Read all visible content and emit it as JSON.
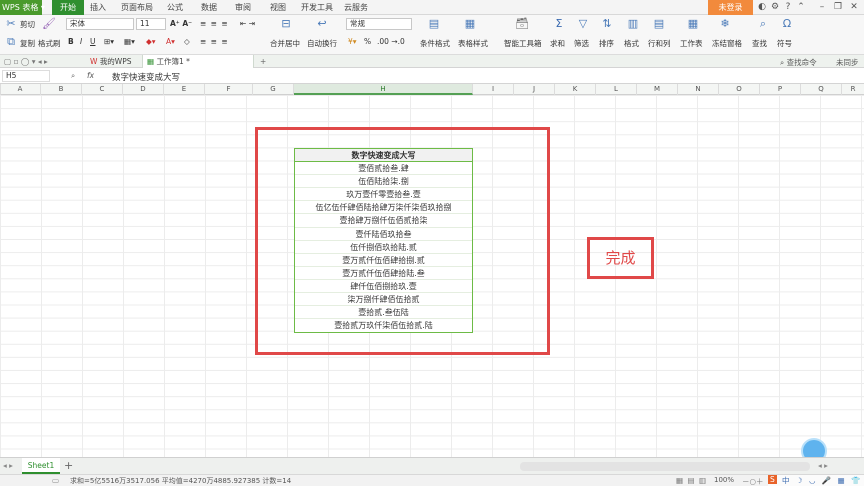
{
  "app": {
    "name": "WPS 表格",
    "login": "未登录"
  },
  "menu": [
    "开始",
    "插入",
    "页面布局",
    "公式",
    "数据",
    "审阅",
    "视图",
    "开发工具",
    "云服务"
  ],
  "ribbon": {
    "cut": "剪切",
    "copy": "复制",
    "format_painter": "格式刷",
    "font_name": "宋体",
    "font_size": "11",
    "style_value": "常规",
    "merge_center": "合并居中",
    "wrap_text": "自动换行",
    "conditional_format": "条件格式",
    "table_style": "表格样式",
    "smart_toolbox": "智能工具箱",
    "sum": "求和",
    "filter": "筛选",
    "sort": "排序",
    "format": "格式",
    "row_col": "行和列",
    "worksheet": "工作表",
    "freeze": "冻结窗格",
    "find": "查找",
    "symbol": "符号",
    "percent": "%"
  },
  "tabs": {
    "home": "我的WPS",
    "doc": "工作簿1 *",
    "find_cmd": "查找命令",
    "unsync": "未同步"
  },
  "formula": {
    "cell_ref": "H5",
    "fx": "fx",
    "content": "数字快速变成大写"
  },
  "columns": [
    "A",
    "B",
    "C",
    "D",
    "E",
    "F",
    "G",
    "H",
    "I",
    "J",
    "K",
    "L",
    "M",
    "N",
    "O",
    "P",
    "Q",
    "R"
  ],
  "table": {
    "header": "数字快速变成大写",
    "rows": [
      "壹佰贰拾叁.肆",
      "伍佰陆拾柒.捌",
      "玖万壹仟零壹拾叁.壹",
      "伍亿伍仟肆佰陆拾肆万柒仟柒佰玖拾捌",
      "壹拾肆万捌仟伍佰贰拾柒",
      "壹仟陆佰玖拾叁",
      "伍仟捌佰玖拾陆.贰",
      "壹万贰仟伍佰肆拾捌.贰",
      "壹万贰仟伍佰肆拾陆.叁",
      "肆仟伍佰捌拾玖.壹",
      "柒万捌仟肆佰伍拾贰",
      "壹拾贰.叁伍陆",
      "壹拾贰万玖仟柒佰伍拾贰.陆"
    ]
  },
  "annotation": "完成",
  "sheet": {
    "name": "Sheet1",
    "add": "+"
  },
  "status": {
    "text": "求和=5亿5516万3517.056   平均值=4270万4885.927385   计数=14",
    "zoom": "100%"
  },
  "colors": {
    "accent": "#2f8f2f",
    "highlight_red": "#e04848",
    "table_border": "#6dbb46"
  }
}
